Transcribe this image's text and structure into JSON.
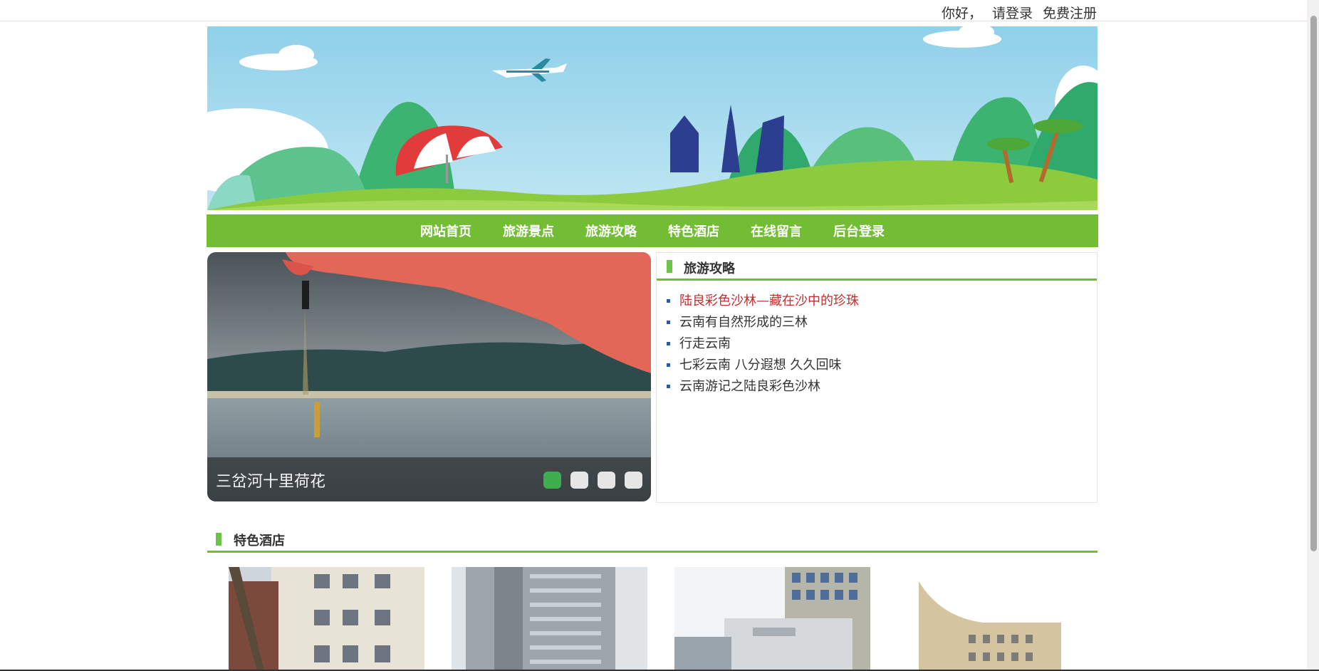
{
  "topbar": {
    "greeting": "你好，",
    "login": "请登录",
    "register": "免费注册"
  },
  "nav": {
    "items": [
      "网站首页",
      "旅游景点",
      "旅游攻略",
      "特色酒店",
      "在线留言",
      "后台登录"
    ]
  },
  "slider": {
    "caption": "三岔河十里荷花",
    "dot_count": 4,
    "active_dot": 1
  },
  "strategy": {
    "title": "旅游攻略",
    "items": [
      "陆良彩色沙林—藏在沙中的珍珠",
      "云南有自然形成的三林",
      "行走云南",
      "七彩云南 八分遐想 久久回味",
      "云南游记之陆良彩色沙林"
    ]
  },
  "hotels": {
    "title": "特色酒店"
  },
  "colors": {
    "accent_green": "#72bd34",
    "link_red": "#c0302b",
    "dot_active": "#3fae50"
  }
}
